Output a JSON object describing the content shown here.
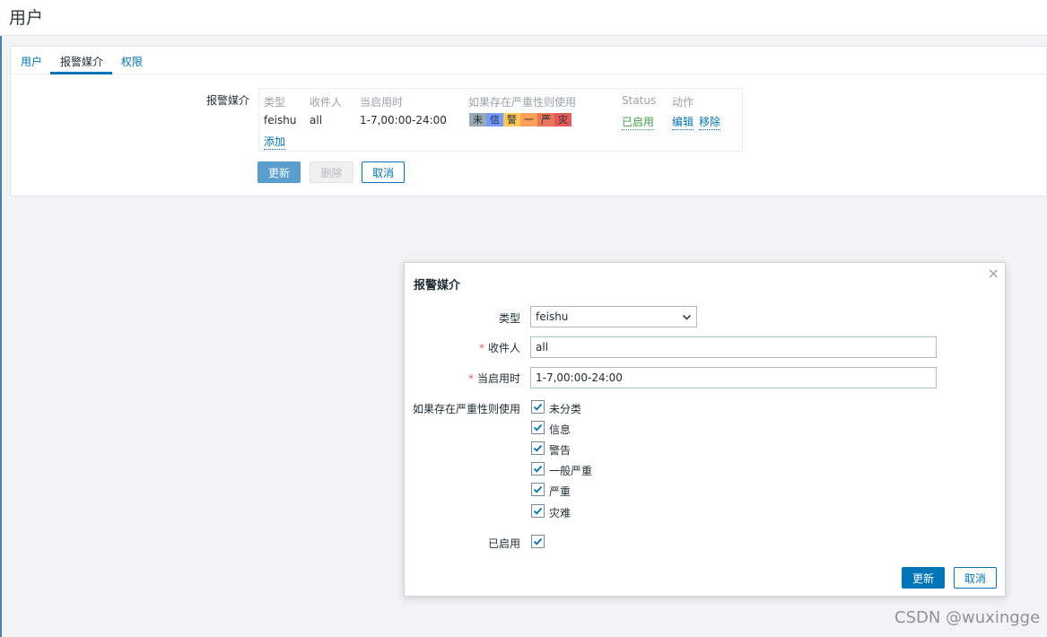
{
  "page": {
    "title": "用户"
  },
  "tabs": [
    {
      "label": "用户"
    },
    {
      "label": "报警媒介"
    },
    {
      "label": "权限"
    }
  ],
  "media": {
    "form_label": "报警媒介",
    "columns": [
      "类型",
      "收件人",
      "当启用时",
      "如果存在严重性则使用",
      "Status",
      "动作"
    ],
    "row": {
      "type": "feishu",
      "recipient": "all",
      "when_active": "1-7,00:00-24:00",
      "severities": [
        {
          "label": "未",
          "color": "#97aab3"
        },
        {
          "label": "信",
          "color": "#7499ff"
        },
        {
          "label": "警",
          "color": "#ffc859"
        },
        {
          "label": "一",
          "color": "#ffa059"
        },
        {
          "label": "严",
          "color": "#e97659"
        },
        {
          "label": "灾",
          "color": "#e45959"
        }
      ],
      "status": "已启用",
      "status_color": "#429e47",
      "actions": {
        "edit": "编辑",
        "remove": "移除"
      }
    },
    "add_link": "添加"
  },
  "buttons": {
    "update": "更新",
    "delete": "删除",
    "cancel": "取消"
  },
  "dialog": {
    "title": "报警媒介",
    "close_icon": "×",
    "type_label": "类型",
    "type_value": "feishu",
    "recipient_label": "收件人",
    "recipient_value": "all",
    "when_label": "当启用时",
    "when_value": "1-7,00:00-24:00",
    "severity_label": "如果存在严重性则使用",
    "severity_options": [
      {
        "label": "未分类",
        "checked": true
      },
      {
        "label": "信息",
        "checked": true
      },
      {
        "label": "警告",
        "checked": true
      },
      {
        "label": "一般严重",
        "checked": true
      },
      {
        "label": "严重",
        "checked": true
      },
      {
        "label": "灾难",
        "checked": true
      }
    ],
    "enabled_label": "已启用",
    "enabled_checked": true,
    "update_button": "更新",
    "cancel_button": "取消",
    "required_mark": "*"
  },
  "watermark": "CSDN @wuxingge",
  "colors": {
    "accent": "#0275b8",
    "enabled": "#429e47",
    "required": "#e45959"
  }
}
